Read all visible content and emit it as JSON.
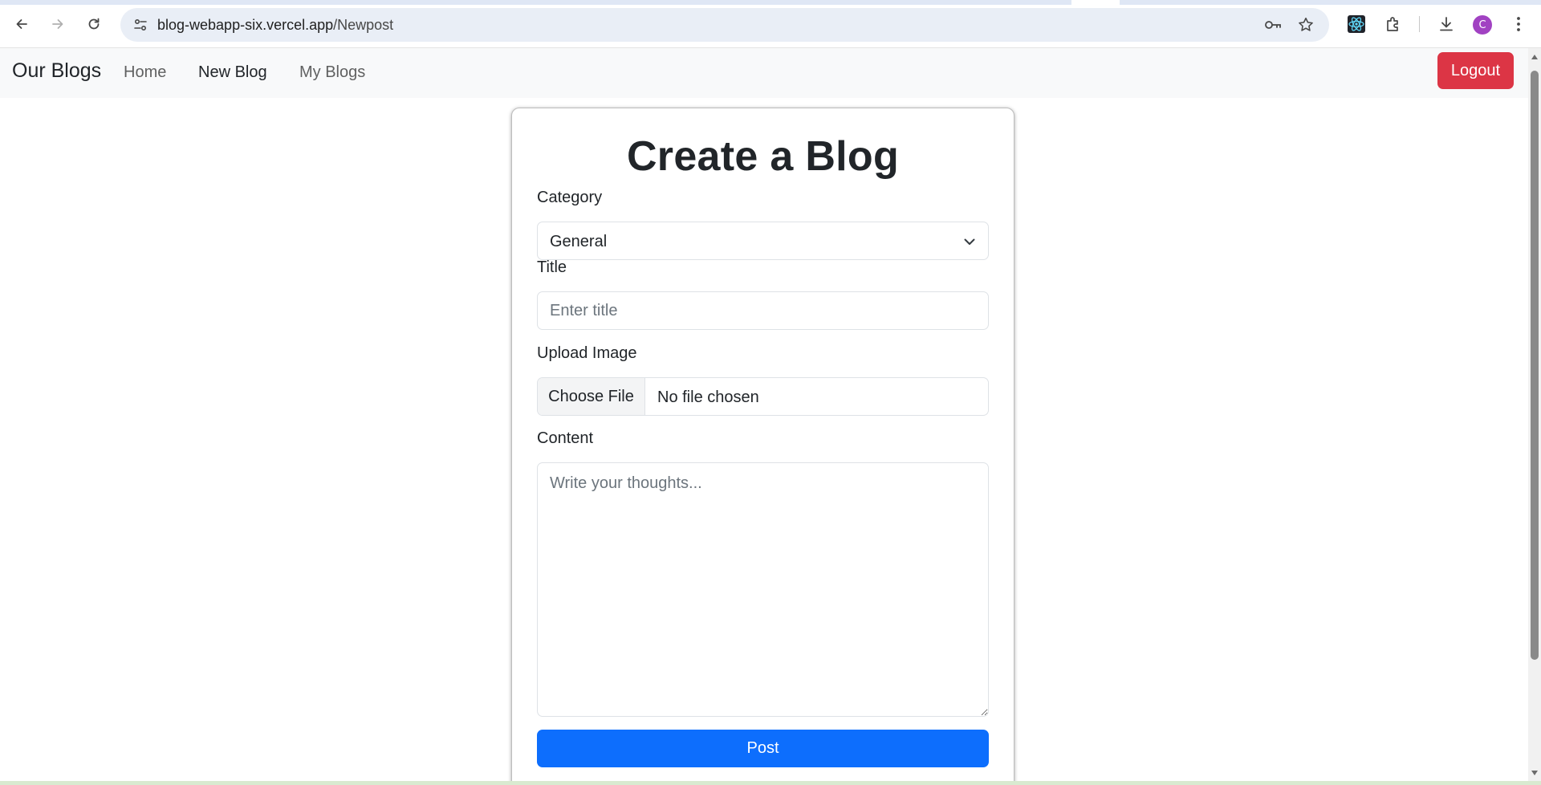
{
  "browser": {
    "url_host": "blog-webapp-six.vercel.app",
    "url_path": "/Newpost",
    "profile_initial": "C",
    "icons": [
      "back-icon",
      "forward-icon",
      "reload-icon",
      "site-info-icon",
      "password-key-icon",
      "bookmark-star-icon",
      "react-devtools-icon",
      "extensions-icon",
      "download-icon",
      "menu-icon"
    ]
  },
  "navbar": {
    "brand": "Our Blogs",
    "links": [
      {
        "label": "Home",
        "active": false
      },
      {
        "label": "New Blog",
        "active": true
      },
      {
        "label": "My Blogs",
        "active": false
      }
    ],
    "logout_label": "Logout"
  },
  "form": {
    "title": "Create a Blog",
    "category_label": "Category",
    "category_value": "General",
    "title_label": "Title",
    "title_placeholder": "Enter title",
    "image_label": "Upload Image",
    "file_button": "Choose File",
    "file_status": "No file chosen",
    "content_label": "Content",
    "content_placeholder": "Write your thoughts...",
    "submit_label": "Post"
  },
  "colors": {
    "logout": "#dc3545",
    "primary": "#0d6efd",
    "navbar_bg": "#f8f9fa",
    "avatar": "#a142c2"
  }
}
